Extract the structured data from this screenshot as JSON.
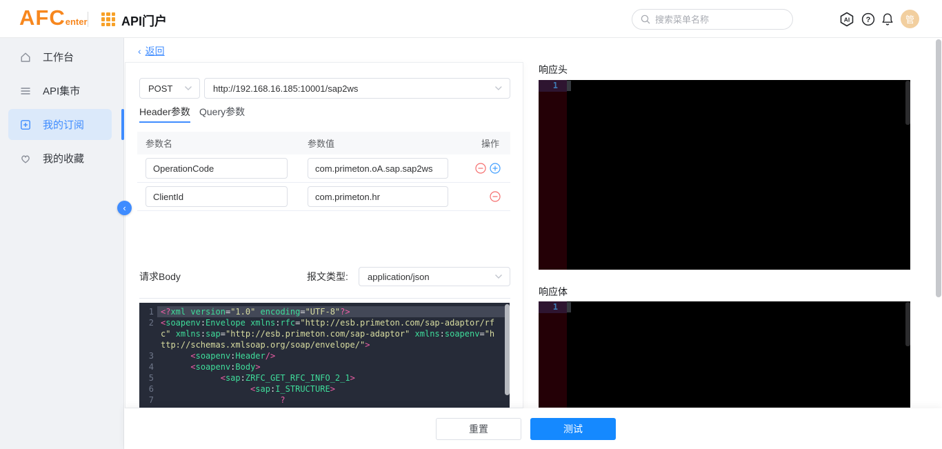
{
  "header": {
    "logo_main": "AFC",
    "logo_sub": "enter",
    "app_title": "API门户",
    "search_placeholder": "搜索菜单名称",
    "ai_icon_text": "AI",
    "help_icon_text": "?",
    "avatar_text": "管"
  },
  "sidebar": {
    "items": [
      {
        "label": "工作台",
        "icon": "home-icon",
        "active": false
      },
      {
        "label": "API集市",
        "icon": "list-icon",
        "active": false
      },
      {
        "label": "我的订阅",
        "icon": "subscribe-icon",
        "active": true
      },
      {
        "label": "我的收藏",
        "icon": "heart-icon",
        "active": false
      }
    ],
    "collapse_glyph": "‹"
  },
  "main": {
    "back_chevron": "‹",
    "back_label": "返回",
    "request": {
      "method": "POST",
      "url": "http://192.168.16.185:10001/sap2ws",
      "tabs": [
        {
          "label": "Header参数",
          "active": true
        },
        {
          "label": "Query参数",
          "active": false
        }
      ],
      "param_table": {
        "columns": [
          "参数名",
          "参数值",
          "操作"
        ],
        "rows": [
          {
            "name": "OperationCode",
            "value": "com.primeton.oA.sap.sap2ws",
            "actions": [
              "remove",
              "add"
            ]
          },
          {
            "name": "ClientId",
            "value": "com.primeton.hr",
            "actions": [
              "remove"
            ]
          }
        ]
      },
      "body_label": "请求Body",
      "content_type_label": "报文类型:",
      "content_type_value": "application/json",
      "code_lines": [
        {
          "n": "1",
          "active": true,
          "tokens": [
            [
              "p",
              "<?"
            ],
            [
              "t",
              "xml"
            ],
            [
              "w",
              " "
            ],
            [
              "t",
              "version"
            ],
            [
              "w",
              "="
            ],
            [
              "s",
              "\"1.0\""
            ],
            [
              "w",
              " "
            ],
            [
              "t",
              "encoding"
            ],
            [
              "w",
              "="
            ],
            [
              "s",
              "\"UTF-8\""
            ],
            [
              "p",
              "?>"
            ]
          ]
        },
        {
          "n": "2",
          "active": false,
          "tokens": [
            [
              "p",
              "<"
            ],
            [
              "t",
              "soapenv"
            ],
            [
              "w",
              ":"
            ],
            [
              "t",
              "Envelope"
            ],
            [
              "w",
              " "
            ],
            [
              "t",
              "xmlns"
            ],
            [
              "w",
              ":"
            ],
            [
              "t",
              "rfc"
            ],
            [
              "w",
              "="
            ],
            [
              "s",
              "\"http://esb.primeton.com/sap-adaptor/rfc\""
            ],
            [
              "w",
              " "
            ],
            [
              "t",
              "xmlns"
            ],
            [
              "w",
              ":"
            ],
            [
              "t",
              "sap"
            ],
            [
              "w",
              "="
            ],
            [
              "s",
              "\"http://esb.primeton.com/sap-adaptor\""
            ],
            [
              "w",
              " "
            ],
            [
              "t",
              "xmlns"
            ],
            [
              "w",
              ":"
            ],
            [
              "t",
              "soapenv"
            ],
            [
              "w",
              "="
            ],
            [
              "s",
              "\"http://schemas.xmlsoap.org/soap/envelope/\""
            ],
            [
              "p",
              ">"
            ]
          ]
        },
        {
          "n": "3",
          "active": false,
          "tokens": [
            [
              "w",
              "      "
            ],
            [
              "p",
              "<"
            ],
            [
              "t",
              "soapenv"
            ],
            [
              "w",
              ":"
            ],
            [
              "t",
              "Header"
            ],
            [
              "p",
              "/>"
            ]
          ]
        },
        {
          "n": "4",
          "active": false,
          "tokens": [
            [
              "w",
              "      "
            ],
            [
              "p",
              "<"
            ],
            [
              "t",
              "soapenv"
            ],
            [
              "w",
              ":"
            ],
            [
              "t",
              "Body"
            ],
            [
              "p",
              ">"
            ]
          ]
        },
        {
          "n": "5",
          "active": false,
          "tokens": [
            [
              "w",
              "            "
            ],
            [
              "p",
              "<"
            ],
            [
              "t",
              "sap"
            ],
            [
              "w",
              ":"
            ],
            [
              "t",
              "ZRFC_GET_RFC_INFO_2_1"
            ],
            [
              "p",
              ">"
            ]
          ]
        },
        {
          "n": "6",
          "active": false,
          "tokens": [
            [
              "w",
              "                  "
            ],
            [
              "p",
              "<"
            ],
            [
              "t",
              "sap"
            ],
            [
              "w",
              ":"
            ],
            [
              "t",
              "I_STRUCTURE"
            ],
            [
              "p",
              ">"
            ]
          ]
        },
        {
          "n": "7",
          "active": false,
          "tokens": [
            [
              "w",
              "                        "
            ],
            [
              "p",
              "?"
            ]
          ]
        }
      ]
    },
    "response": {
      "headers_label": "响应头",
      "body_label": "响应体",
      "line_number": "1"
    },
    "footer": {
      "reset_label": "重置",
      "test_label": "测试"
    }
  },
  "colors": {
    "brand_orange": "#f7871e",
    "accent_blue": "#3f8cff",
    "primary_button_blue": "#1589ff",
    "danger_red": "#f56c6c",
    "add_blue": "#409eff",
    "editor_bg": "#262b38",
    "editor_tag_green": "#3fdd9b",
    "editor_punct_pink": "#ef5fa7",
    "editor_string_yellow": "#d8dca0",
    "response_gutter_maroon": "#240006",
    "response_line1_purple": "#2e1530"
  }
}
